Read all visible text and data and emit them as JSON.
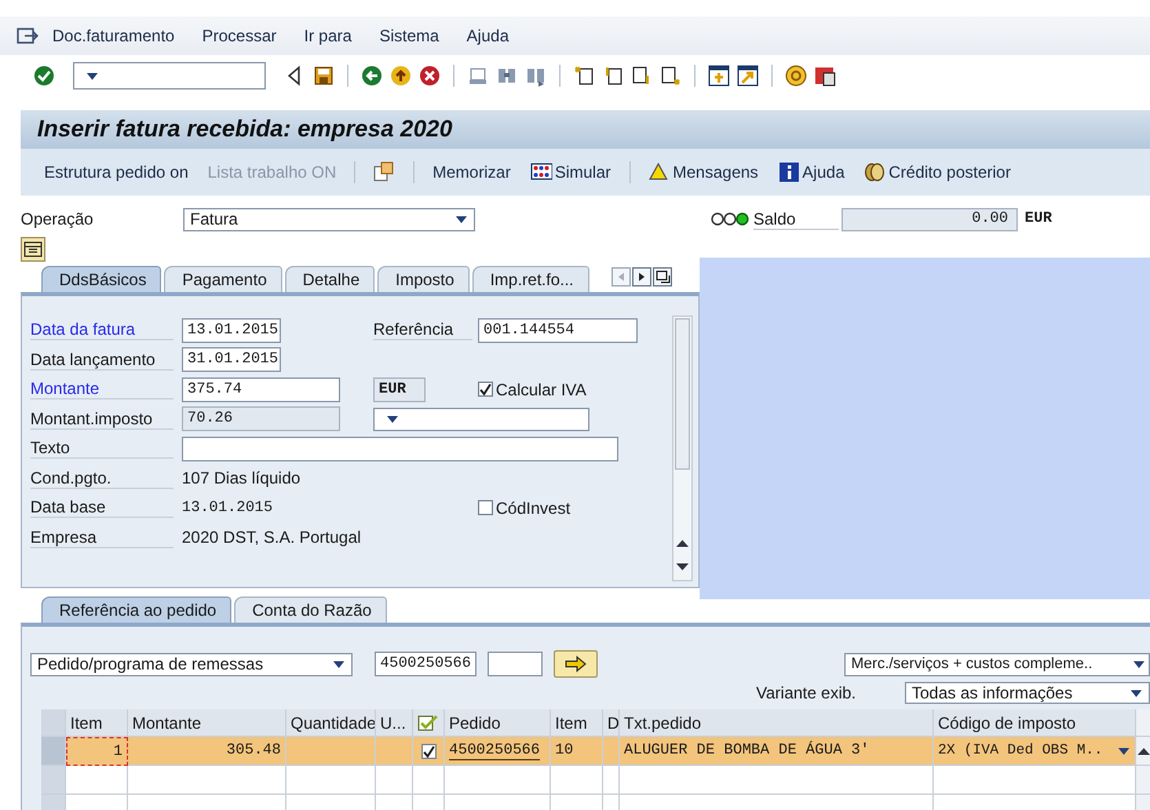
{
  "menu": [
    "Doc.faturamento",
    "Processar",
    "Ir para",
    "Sistema",
    "Ajuda"
  ],
  "title": "Inserir fatura recebida: empresa 2020",
  "app_toolbar": [
    {
      "kind": "button",
      "label": "Estrutura pedido on",
      "disabled": false
    },
    {
      "kind": "button",
      "label": "Lista trabalho ON",
      "disabled": true
    },
    {
      "kind": "separator"
    },
    {
      "kind": "icon_button"
    },
    {
      "kind": "separator"
    },
    {
      "kind": "button",
      "label": "Memorizar",
      "disabled": false
    },
    {
      "kind": "button",
      "label": "Simular",
      "disabled": false
    },
    {
      "kind": "separator"
    },
    {
      "kind": "button",
      "label": "Mensagens",
      "disabled": false
    },
    {
      "kind": "button",
      "label": "Ajuda",
      "disabled": false
    },
    {
      "kind": "button",
      "label": "Crédito posterior",
      "disabled": false
    }
  ],
  "operation": {
    "label": "Operação",
    "value": "Fatura"
  },
  "balance": {
    "label": "Saldo",
    "value": "0.00",
    "currency": "EUR",
    "lights": [
      {
        "on": false
      },
      {
        "on": false
      },
      {
        "on": true
      }
    ]
  },
  "header_tabs": [
    {
      "label": "DdsBásicos",
      "selected": true
    },
    {
      "label": "Pagamento",
      "selected": false
    },
    {
      "label": "Detalhe",
      "selected": false
    },
    {
      "label": "Imposto",
      "selected": false
    },
    {
      "label": "Imp.ret.fo...",
      "selected": false
    }
  ],
  "basic_data": {
    "rows": [
      {
        "label": "Data da fatura",
        "required": true,
        "kind": "date",
        "value": "13.01.2015",
        "extras": [
          {
            "kind": "labeled_input",
            "label": "Referência",
            "value": "001.144554"
          }
        ]
      },
      {
        "label": "Data lançamento",
        "required": false,
        "kind": "date",
        "value": "31.01.2015"
      },
      {
        "label": "Montante",
        "required": true,
        "kind": "amount",
        "value": "375.74",
        "extras": [
          {
            "kind": "currency",
            "value": "EUR"
          },
          {
            "kind": "checkbox",
            "label": "Calcular IVA",
            "checked": true
          }
        ]
      },
      {
        "label": "Montant.imposto",
        "required": false,
        "kind": "readonly",
        "value": "70.26",
        "extras": [
          {
            "kind": "dropdown"
          }
        ]
      },
      {
        "label": "Texto",
        "required": false,
        "kind": "wide"
      },
      {
        "label": "Cond.pgto.",
        "required": false,
        "kind": "text",
        "value": "107 Dias líquido"
      },
      {
        "label": "Data base",
        "required": false,
        "kind": "mono",
        "value": "13.01.2015",
        "extras": [
          {
            "kind": "checkbox",
            "label": "CódInvest",
            "checked": false
          }
        ]
      },
      {
        "label": "Empresa",
        "required": false,
        "kind": "text",
        "value": "2020 DST, S.A. Portugal"
      }
    ]
  },
  "lower_tabs": [
    {
      "label": "Referência ao pedido",
      "selected": true
    },
    {
      "label": "Conta do Razão",
      "selected": false
    }
  ],
  "reference": {
    "document_type": "Pedido/programa de remessas",
    "order": "4500250566",
    "scope": "Merc./serviços + custos compleme..",
    "variant_label": "Variante exib.",
    "variant": "Todas as informações"
  },
  "table": {
    "columns": [
      {
        "kind": "text",
        "label": "Item"
      },
      {
        "kind": "text",
        "label": "Montante"
      },
      {
        "kind": "text",
        "label": "Quantidade"
      },
      {
        "kind": "text",
        "label": "U..."
      },
      {
        "kind": "icon"
      },
      {
        "kind": "text",
        "label": "Pedido"
      },
      {
        "kind": "text",
        "label": "Item"
      },
      {
        "kind": "text",
        "label": "D"
      },
      {
        "kind": "text",
        "label": "Txt.pedido"
      },
      {
        "kind": "text",
        "label": "Código de imposto"
      }
    ],
    "rows": [
      {
        "selected": true,
        "item": "1",
        "amount": "305.48",
        "checked": true,
        "order": "4500250566",
        "order_item": "10",
        "order_text": "ALUGUER DE BOMBA DE ÁGUA 3'",
        "tax_code": "2X (IVA Ded OBS M.."
      }
    ]
  }
}
